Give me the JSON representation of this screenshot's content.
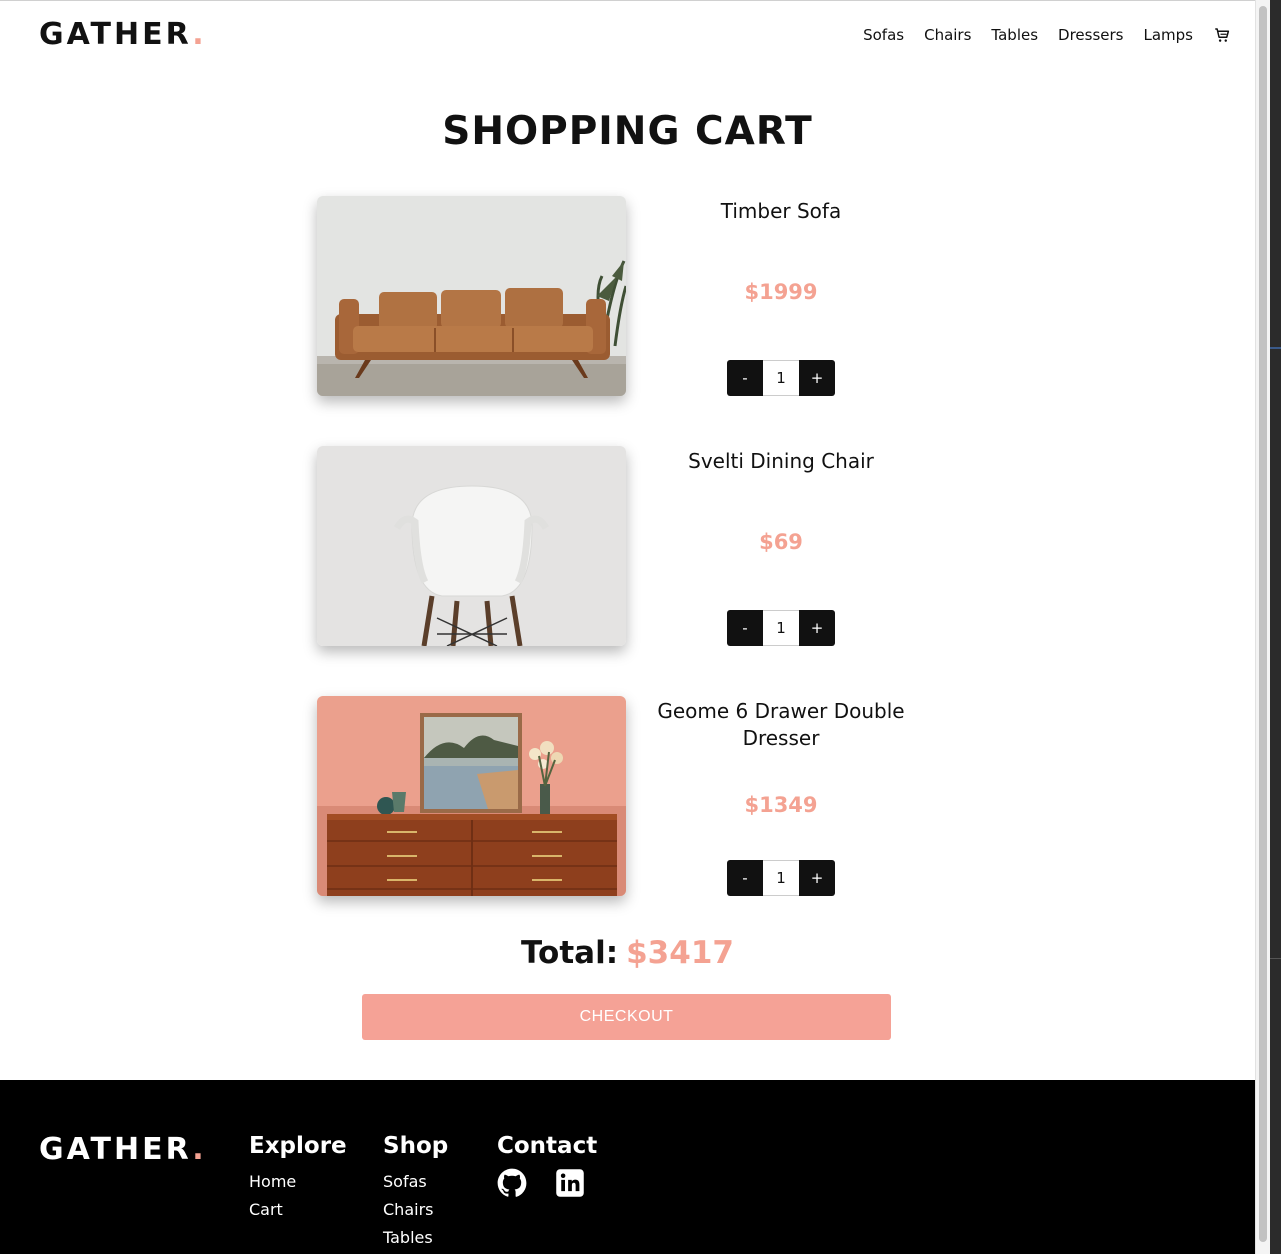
{
  "brand": {
    "name": "GATHER",
    "dot": "."
  },
  "nav": {
    "links": [
      "Sofas",
      "Chairs",
      "Tables",
      "Dressers",
      "Lamps"
    ],
    "cart_icon": "cart-icon"
  },
  "page_title": "SHOPPING CART",
  "items": [
    {
      "name": "Timber Sofa",
      "price": "$1999",
      "qty": "1",
      "minus": "-",
      "plus": "+",
      "image": "leather-sofa-photo"
    },
    {
      "name": "Svelti Dining Chair",
      "price": "$69",
      "qty": "1",
      "minus": "-",
      "plus": "+",
      "image": "white-chair-photo"
    },
    {
      "name": "Geome 6 Drawer Double Dresser",
      "price": "$1349",
      "qty": "1",
      "minus": "-",
      "plus": "+",
      "image": "wood-dresser-photo"
    }
  ],
  "total": {
    "label": "Total:",
    "amount": "$3417"
  },
  "checkout_label": "CHECKOUT",
  "footer": {
    "explore": {
      "heading": "Explore",
      "links": [
        "Home",
        "Cart"
      ]
    },
    "shop": {
      "heading": "Shop",
      "links": [
        "Sofas",
        "Chairs",
        "Tables"
      ]
    },
    "contact": {
      "heading": "Contact",
      "icons": [
        "github-icon",
        "linkedin-icon"
      ]
    }
  },
  "colors": {
    "accent": "#f4a292",
    "checkout_bg": "#f5a296",
    "dark": "#111111",
    "footer_bg": "#000000"
  }
}
